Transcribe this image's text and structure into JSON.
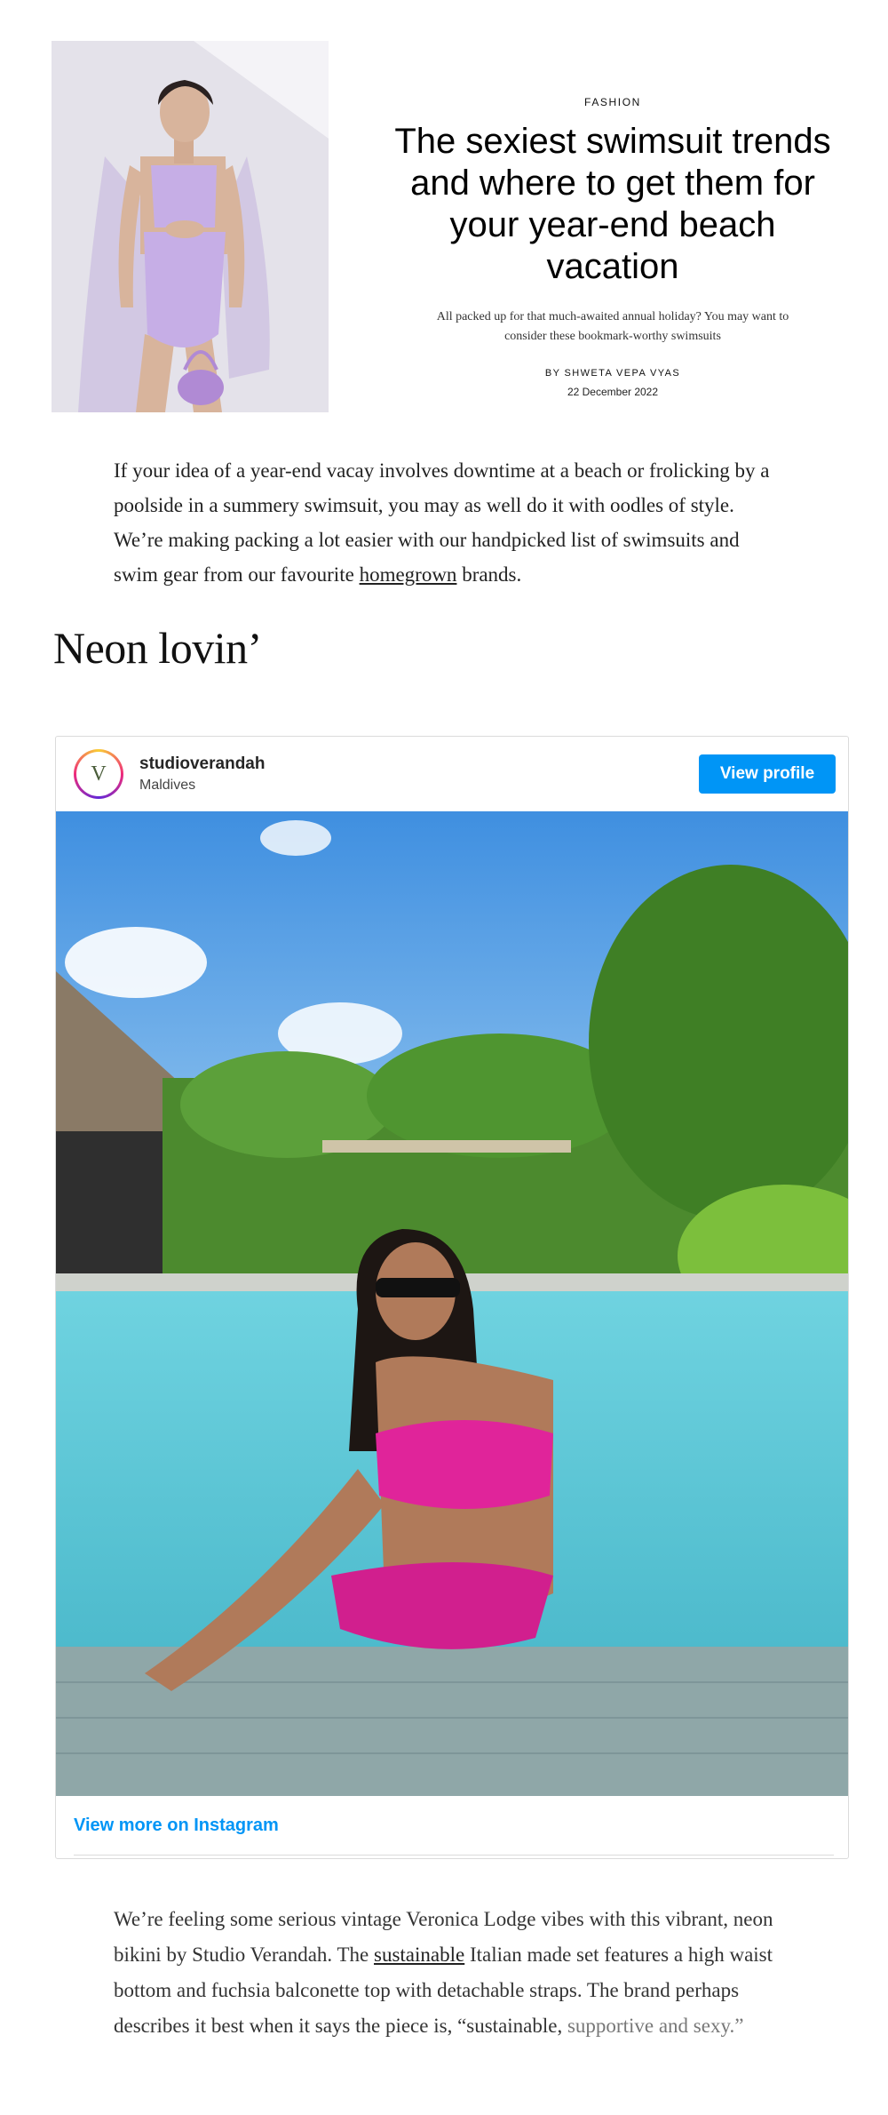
{
  "article": {
    "category": "FASHION",
    "headline": "The sexiest swimsuit trends and where to get them for your year-end beach vacation",
    "subheadline": "All packed up for that much-awaited annual holiday? You may want to consider these bookmark-worthy swimsuits",
    "byline": "BY SHWETA VEPA VYAS",
    "date": "22 December 2022",
    "intro_before_link": "If your idea of a year-end vacay involves downtime at a beach or frolicking by a poolside in a summery swimsuit, you may as well do it with oodles of style. We’re making packing a lot easier with our handpicked list of swimsuits and swim gear from our favourite ",
    "intro_link": "homegrown",
    "intro_after_link": " brands."
  },
  "section": {
    "heading": "Neon lovin’"
  },
  "instagram_embed": {
    "username": "studioverandah",
    "location": "Maldives",
    "avatar_letter": "V",
    "view_profile_label": "View profile",
    "view_more_label": "View more on Instagram"
  },
  "paragraph2": {
    "before_link": "We’re feeling some serious vintage Veronica Lodge vibes with this vibrant, neon bikini by Studio Verandah. The ",
    "link": "sustainable",
    "after_link": " Italian made set features a high waist bottom and fuchsia balconette top with detachable straps. The brand perhaps describes it best when it says the piece is, “sustainable, ",
    "faded_tail": "supportive and sexy.”"
  },
  "colors": {
    "ig_blue": "#0095f6",
    "swimsuit_lilac": "#c6aee6",
    "bikini_fuchsia": "#e0249a",
    "pool_turquoise": "#4fc3d6"
  }
}
